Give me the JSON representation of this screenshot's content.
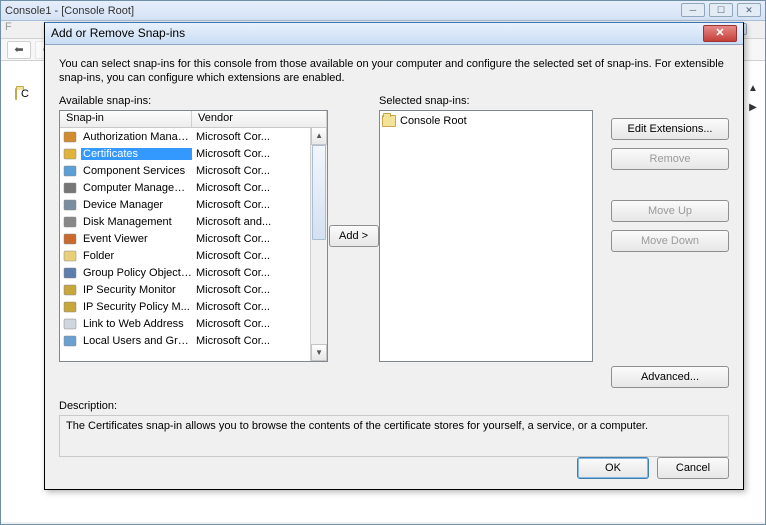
{
  "mmc": {
    "title": "Console1 - [Console Root]",
    "sub_title": "[",
    "tree_root": "C",
    "menu_first": "F"
  },
  "dialog": {
    "title": "Add or Remove Snap-ins",
    "intro": "You can select snap-ins for this console from those available on your computer and configure the selected set of snap-ins. For extensible snap-ins, you can configure which extensions are enabled.",
    "available_label": "Available snap-ins:",
    "selected_label": "Selected snap-ins:",
    "columns": {
      "snapin": "Snap-in",
      "vendor": "Vendor"
    },
    "add_btn": "Add >",
    "buttons": {
      "edit_ext": "Edit Extensions...",
      "remove": "Remove",
      "move_up": "Move Up",
      "move_down": "Move Down",
      "advanced": "Advanced...",
      "ok": "OK",
      "cancel": "Cancel"
    },
    "available": [
      {
        "name": "Authorization Manager",
        "vendor": "Microsoft Cor...",
        "icon": "#d28b2e",
        "selected": false
      },
      {
        "name": "Certificates",
        "vendor": "Microsoft Cor...",
        "icon": "#e0b33a",
        "selected": true
      },
      {
        "name": "Component Services",
        "vendor": "Microsoft Cor...",
        "icon": "#5c9ed6",
        "selected": false
      },
      {
        "name": "Computer Managem...",
        "vendor": "Microsoft Cor...",
        "icon": "#777",
        "selected": false
      },
      {
        "name": "Device Manager",
        "vendor": "Microsoft Cor...",
        "icon": "#7a8ea0",
        "selected": false
      },
      {
        "name": "Disk Management",
        "vendor": "Microsoft and...",
        "icon": "#888",
        "selected": false
      },
      {
        "name": "Event Viewer",
        "vendor": "Microsoft Cor...",
        "icon": "#c96a2c",
        "selected": false
      },
      {
        "name": "Folder",
        "vendor": "Microsoft Cor...",
        "icon": "#e8cf78",
        "selected": false
      },
      {
        "name": "Group Policy Object ...",
        "vendor": "Microsoft Cor...",
        "icon": "#5d7dad",
        "selected": false
      },
      {
        "name": "IP Security Monitor",
        "vendor": "Microsoft Cor...",
        "icon": "#c7a63a",
        "selected": false
      },
      {
        "name": "IP Security Policy M...",
        "vendor": "Microsoft Cor...",
        "icon": "#c7a63a",
        "selected": false
      },
      {
        "name": "Link to Web Address",
        "vendor": "Microsoft Cor...",
        "icon": "#cfd6dd",
        "selected": false
      },
      {
        "name": "Local Users and Gro...",
        "vendor": "Microsoft Cor...",
        "icon": "#6aa0d0",
        "selected": false
      }
    ],
    "selected_list": [
      {
        "name": "Console Root"
      }
    ],
    "description_label": "Description:",
    "description_text": "The Certificates snap-in allows you to browse the contents of the certificate stores for yourself, a service, or a computer."
  }
}
